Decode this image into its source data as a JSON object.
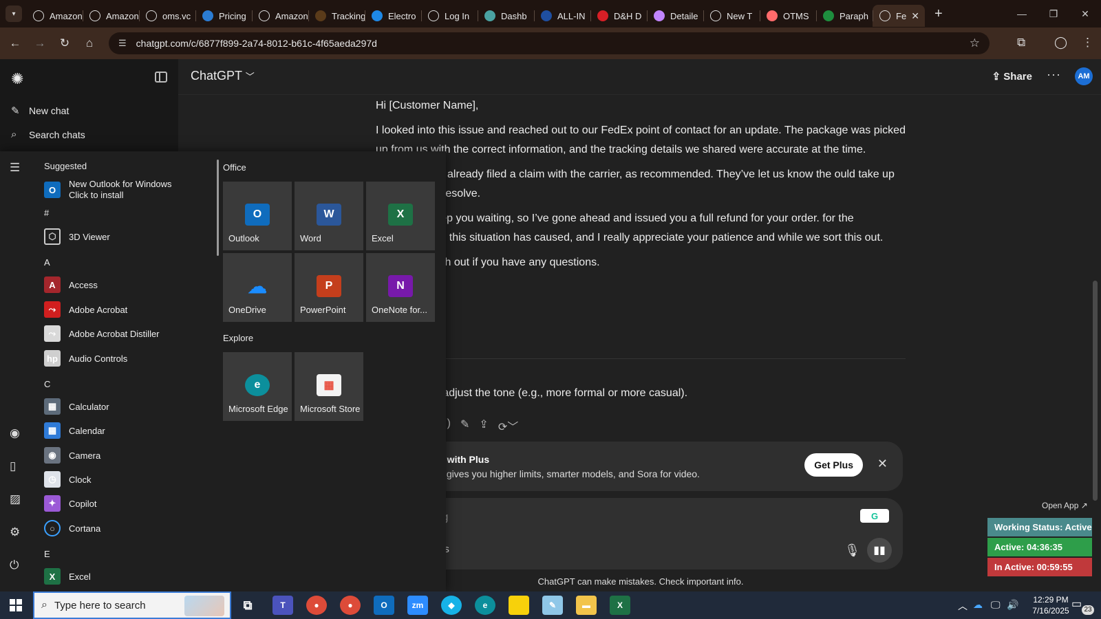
{
  "browser": {
    "tabs": [
      {
        "title": "Amazon",
        "favicon": "amazon-icon",
        "color": "#ffffff"
      },
      {
        "title": "Amazon",
        "favicon": "amazon-icon",
        "color": "#ffffff"
      },
      {
        "title": "oms.vc",
        "favicon": "triangle-icon",
        "color": "#ffffff"
      },
      {
        "title": "Pricing",
        "favicon": "dollar-icon",
        "color": "#2b7cd3"
      },
      {
        "title": "Amazon",
        "favicon": "amazon-icon",
        "color": "#ffffff"
      },
      {
        "title": "Tracking",
        "favicon": "ups-icon",
        "color": "#5a3b1a"
      },
      {
        "title": "Electro",
        "favicon": "ec-icon",
        "color": "#1e88e5"
      },
      {
        "title": "Log In",
        "favicon": "login-icon",
        "color": "#ffffff"
      },
      {
        "title": "Dashb",
        "favicon": "diamond-icon",
        "color": "#4aa3a3"
      },
      {
        "title": "ALL-IN",
        "favicon": "17track-icon",
        "color": "#1f4fa0"
      },
      {
        "title": "D&H D",
        "favicon": "dh-icon",
        "color": "#d61f26"
      },
      {
        "title": "Detaile",
        "favicon": "chart-icon",
        "color": "#c084fc"
      },
      {
        "title": "New T",
        "favicon": "chatgpt-icon",
        "color": "#ffffff"
      },
      {
        "title": "OTMS",
        "favicon": "otms-icon",
        "color": "#ff6b6b"
      },
      {
        "title": "Paraph",
        "favicon": "sheets-icon",
        "color": "#1e8e3e"
      },
      {
        "title": "Fe",
        "favicon": "chatgpt-icon",
        "color": "#ffffff",
        "active": true
      }
    ],
    "url": "chatgpt.com/c/6877f899-2a74-8012-b61c-4f65aeda297d"
  },
  "chatgpt": {
    "model_label": "ChatGPT",
    "share_label": "Share",
    "avatar_initials": "AM",
    "sidebar": {
      "new_chat": "New chat",
      "search_chats": "Search chats"
    },
    "messages": [
      "Hi [Customer Name],",
      "I looked into this issue and reached out to our FedEx point of contact for an update. The package was picked up from us with the correct information, and the tracking details we shared were accurate at the time.",
      "s forward, I’ve already filed a claim with the carrier, as recommended. They’ve let us know the ould take up to 45 days to resolve.",
      "n’t want to keep you waiting, so I’ve gone ahead and issued you a full refund for your order. for the inconvenience this situation has caused, and I really appreciate your patience and while we sort this out.",
      "esitate to reach out if you have any questions."
    ],
    "followup": "f you'd like to adjust the tone (e.g., more formal or more casual).",
    "plus_banner": {
      "title": "e with Plus",
      "subtitle": "s gives you higher limits, smarter models, and Sora for video.",
      "button": "Get Plus"
    },
    "composer": {
      "placeholder": "g",
      "tools_label": "ls"
    },
    "disclaimer": "ChatGPT can make mistakes. Check important info."
  },
  "time_tracker": {
    "open_app": "Open App ↗",
    "status": "Working Status: Active",
    "active": "Active: 04:36:35",
    "inactive": "In Active: 00:59:55",
    "colors": {
      "status": "#4a8a8c",
      "active": "#2e9e4a",
      "inactive": "#c0393b"
    }
  },
  "start_menu": {
    "list": [
      {
        "type": "heading",
        "text": "Suggested"
      },
      {
        "type": "app",
        "name": "New Outlook for Windows",
        "sub": "Click to install",
        "icon": "outlook-new-icon",
        "color": "#0f6cbd",
        "glyph": "O"
      },
      {
        "type": "heading",
        "text": "#"
      },
      {
        "type": "app",
        "name": "3D Viewer",
        "icon": "cube-icon",
        "color": "transparent",
        "glyph": "⬡"
      },
      {
        "type": "heading",
        "text": "A"
      },
      {
        "type": "app",
        "name": "Access",
        "icon": "access-icon",
        "color": "#a4262c",
        "glyph": "A"
      },
      {
        "type": "app",
        "name": "Adobe Acrobat",
        "icon": "acrobat-icon",
        "color": "#d11f1f",
        "glyph": "⤳"
      },
      {
        "type": "app",
        "name": "Adobe Acrobat Distiller",
        "icon": "distiller-icon",
        "color": "#d9d9d9",
        "glyph": "⤳"
      },
      {
        "type": "app",
        "name": "Audio Controls",
        "icon": "hp-icon",
        "color": "#cfcfcf",
        "glyph": "hp"
      },
      {
        "type": "heading",
        "text": "C"
      },
      {
        "type": "app",
        "name": "Calculator",
        "icon": "calculator-icon",
        "color": "#5d6b7a",
        "glyph": "▦"
      },
      {
        "type": "app",
        "name": "Calendar",
        "icon": "calendar-icon",
        "color": "#2f7bd8",
        "glyph": "▦"
      },
      {
        "type": "app",
        "name": "Camera",
        "icon": "camera-icon",
        "color": "#6a7380",
        "glyph": "◉"
      },
      {
        "type": "app",
        "name": "Clock",
        "icon": "clock-icon",
        "color": "#dfe3ea",
        "glyph": "◷"
      },
      {
        "type": "app",
        "name": "Copilot",
        "icon": "copilot-icon",
        "color": "#9b59d6",
        "glyph": "✦"
      },
      {
        "type": "app",
        "name": "Cortana",
        "icon": "cortana-icon",
        "color": "transparent",
        "glyph": "○"
      },
      {
        "type": "heading",
        "text": "E"
      },
      {
        "type": "app",
        "name": "Excel",
        "icon": "excel-icon",
        "color": "#1e7145",
        "glyph": "X"
      }
    ],
    "groups": [
      {
        "title": "Office",
        "tiles": [
          {
            "label": "Outlook",
            "icon": "outlook-icon",
            "color": "#0f6cbd",
            "glyph": "O"
          },
          {
            "label": "Word",
            "icon": "word-icon",
            "color": "#2b579a",
            "glyph": "W"
          },
          {
            "label": "Excel",
            "icon": "excel-icon",
            "color": "#1e7145",
            "glyph": "X"
          },
          {
            "label": "OneDrive",
            "icon": "onedrive-icon",
            "color": "#1a8cff",
            "glyph": "☁"
          },
          {
            "label": "PowerPoint",
            "icon": "powerpoint-icon",
            "color": "#c43e1c",
            "glyph": "P"
          },
          {
            "label": "OneNote for...",
            "icon": "onenote-icon",
            "color": "#7719aa",
            "glyph": "N"
          }
        ]
      },
      {
        "title": "Explore",
        "tiles": [
          {
            "label": "Microsoft Edge",
            "icon": "edge-icon",
            "color": "#0c8f9c",
            "glyph": "e"
          },
          {
            "label": "Microsoft Store",
            "icon": "store-icon",
            "color": "#f3f3f3",
            "glyph": "▦"
          }
        ]
      }
    ]
  },
  "taskbar": {
    "search_placeholder": "Type here to search",
    "apps": [
      {
        "name": "task-view-icon",
        "color": "transparent",
        "glyph": "⧉"
      },
      {
        "name": "teams-icon",
        "color": "#4b53bc",
        "glyph": "T"
      },
      {
        "name": "chrome-icon",
        "color": "#dd4b39",
        "glyph": "●"
      },
      {
        "name": "chrome-profile-icon",
        "color": "#dd4b39",
        "glyph": "●"
      },
      {
        "name": "outlook-icon",
        "color": "#0f6cbd",
        "glyph": "O"
      },
      {
        "name": "zoom-icon",
        "color": "#2d8cff",
        "glyph": "zm"
      },
      {
        "name": "kodi-icon",
        "color": "#17b2e7",
        "glyph": "◆"
      },
      {
        "name": "edge-icon",
        "color": "#0c8f9c",
        "glyph": "e"
      },
      {
        "name": "sticky-notes-icon",
        "color": "#f7d10b",
        "glyph": " "
      },
      {
        "name": "notepad-icon",
        "color": "#8fc7e8",
        "glyph": "✎"
      },
      {
        "name": "file-explorer-icon",
        "color": "#f2c44b",
        "glyph": "▬"
      },
      {
        "name": "excel-icon",
        "color": "#1e7145",
        "glyph": "X"
      }
    ],
    "time": "12:29 PM",
    "date": "7/16/2025",
    "notification_count": "23"
  }
}
